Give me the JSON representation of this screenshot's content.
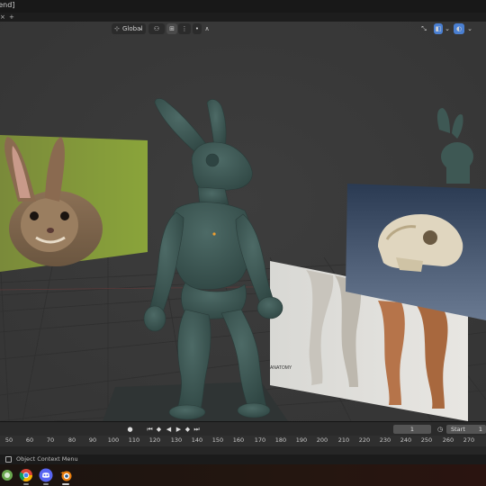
{
  "window": {
    "title": "lend]",
    "tab_close": "×",
    "tab_add": "+"
  },
  "viewport_header": {
    "transform_orientation": "Global",
    "pivot_icon": "pivot-point-icon",
    "snap_icon": "snap-icon",
    "proportional_icon": "proportional-editing-icon",
    "gizmo_icon": "gizmo-icon",
    "overlay_icon": "overlay-icon",
    "shading_icon": "viewport-shading-icon"
  },
  "timeline": {
    "current_frame": "1",
    "start_label": "Start",
    "start_value": "1",
    "ruler_ticks": [
      "50",
      "60",
      "70",
      "80",
      "90",
      "100",
      "110",
      "120",
      "130",
      "140",
      "150",
      "160",
      "170",
      "180",
      "190",
      "200",
      "210",
      "220",
      "230",
      "240",
      "250",
      "260",
      "270"
    ]
  },
  "status_bar": {
    "text": "Object Context Menu"
  },
  "taskbar": {
    "apps": [
      "chrome-icon",
      "discord-icon",
      "blender-icon"
    ]
  },
  "colors": {
    "viewport_bg": "#393939",
    "grid": "#2f2f2f",
    "model": "#3f5a56",
    "accent": "#4a7fd1"
  }
}
